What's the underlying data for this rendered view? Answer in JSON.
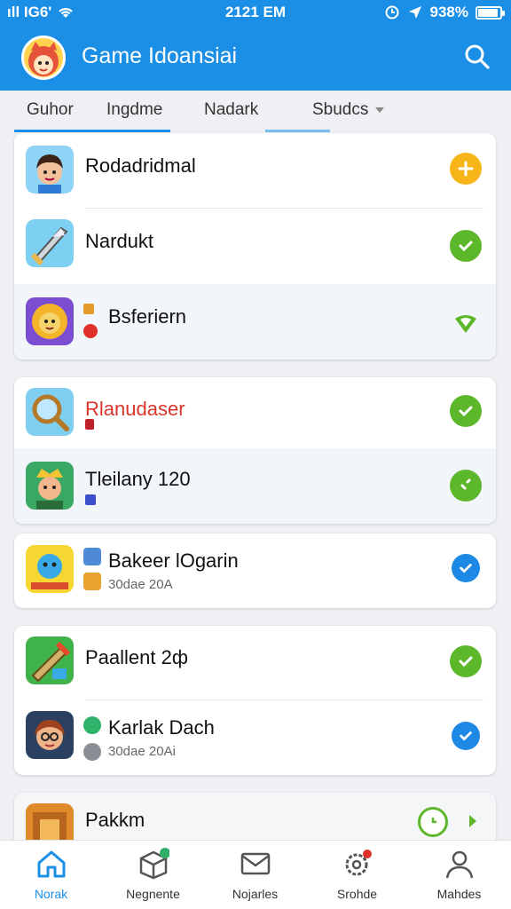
{
  "status_bar": {
    "signal": "ıll IG6'",
    "time": "2121 EM",
    "battery": "938%",
    "battery_level": 0.9
  },
  "app_bar": {
    "title": "Game Idoansiai",
    "logo_icon": "fox-mascot-icon",
    "search_icon": "search-icon"
  },
  "tabs": [
    {
      "label": "Guhor"
    },
    {
      "label": "Ingdme"
    },
    {
      "label": "Nadark"
    },
    {
      "label": "Sbudcs"
    }
  ],
  "colors": {
    "primary": "#1b8fe6",
    "green": "#5cb82a",
    "yellow": "#f7b51a",
    "blue": "#1e88e5",
    "red": "#d9352b"
  },
  "cards": [
    {
      "rows": [
        {
          "name": "Rodadridmal",
          "status": "add-icon"
        },
        {
          "name": "Nardukt",
          "status": "check-icon"
        },
        {
          "name": "Bsferiern",
          "status": "shield-icon"
        }
      ]
    },
    {
      "rows": [
        {
          "name": "Rlanudaser",
          "status": "check-icon"
        },
        {
          "name": "Tleilany 120",
          "status": "check-icon"
        }
      ]
    },
    {
      "rows": [
        {
          "name": "Bakeer lOgarin",
          "sub": "30dae 20A",
          "status": "check-icon"
        }
      ]
    },
    {
      "rows": [
        {
          "name": "Paallent 2ф",
          "status": "check-icon"
        },
        {
          "name": "Karlak Dach",
          "sub": "30dae 20Ai",
          "status": "check-icon"
        }
      ]
    },
    {
      "rows": [
        {
          "name": "Pakkm",
          "status": "refresh-icon"
        }
      ]
    }
  ],
  "bottom_nav": [
    {
      "label": "Norak",
      "icon": "home-icon"
    },
    {
      "label": "Negnente",
      "icon": "box-icon"
    },
    {
      "label": "Nojarles",
      "icon": "mail-icon"
    },
    {
      "label": "Srohde",
      "icon": "settings-icon"
    },
    {
      "label": "Mahdes",
      "icon": "profile-icon"
    }
  ]
}
